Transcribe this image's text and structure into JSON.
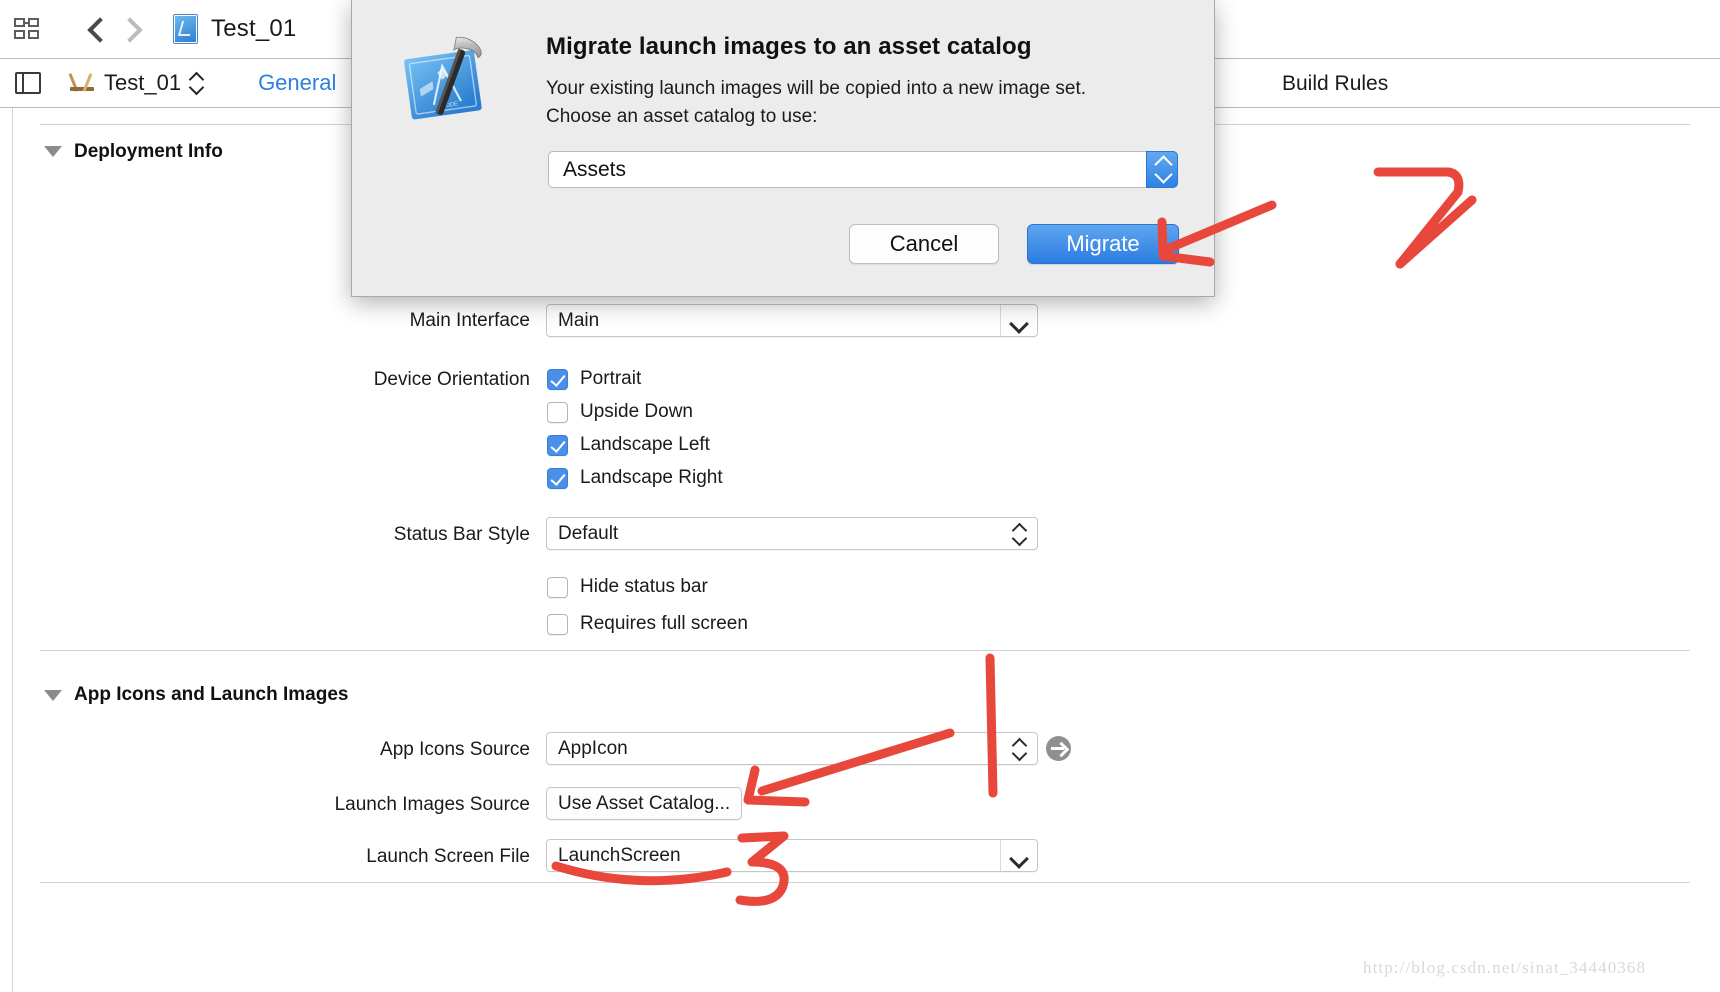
{
  "toolbar": {
    "grid_icon": "grid-icon",
    "back_icon": "chevron-left-icon",
    "forward_icon": "chevron-right-icon",
    "file_icon": "xcode-project-file-icon",
    "title": "Test_01"
  },
  "tabbar": {
    "panel_icon": "left-panel-toggle-icon",
    "target_icon": "target-ruler-icon",
    "scheme_name": "Test_01",
    "stepper_icon": "up-down-stepper-icon",
    "tabs": [
      {
        "label": "General",
        "active": true
      },
      {
        "label": "Build Rules",
        "active": false
      }
    ]
  },
  "sections": {
    "deployment_info": {
      "title": "Deployment Info",
      "disclosure_icon": "triangle-down-icon",
      "rows": {
        "main_interface": {
          "label": "Main Interface",
          "value": "Main",
          "control": "combo-box",
          "icon": "chevron-down-icon"
        },
        "device_orientation": {
          "label": "Device Orientation",
          "options": [
            {
              "label": "Portrait",
              "checked": true
            },
            {
              "label": "Upside Down",
              "checked": false
            },
            {
              "label": "Landscape Left",
              "checked": true
            },
            {
              "label": "Landscape Right",
              "checked": true
            }
          ]
        },
        "status_bar_style": {
          "label": "Status Bar Style",
          "value": "Default",
          "control": "popup-button",
          "icon": "up-down-stepper-icon"
        },
        "extra_checks": [
          {
            "label": "Hide status bar",
            "checked": false
          },
          {
            "label": "Requires full screen",
            "checked": false
          }
        ]
      }
    },
    "app_icons_and_launch_images": {
      "title": "App Icons and Launch Images",
      "disclosure_icon": "triangle-down-icon",
      "rows": {
        "app_icons_source": {
          "label": "App Icons Source",
          "value": "AppIcon",
          "icon": "up-down-stepper-icon",
          "goto_icon": "arrow-right-circle-icon"
        },
        "launch_images_source": {
          "label": "Launch Images Source",
          "value": "Use Asset Catalog..."
        },
        "launch_screen_file": {
          "label": "Launch Screen File",
          "value": "LaunchScreen",
          "icon": "chevron-down-icon"
        }
      }
    }
  },
  "dialog": {
    "icon": "xcode-hammer-blueprint-icon",
    "title": "Migrate launch images to an asset catalog",
    "body_line1": "Your existing launch images will be copied into a new image set.",
    "body_line2": "Choose an asset catalog to use:",
    "catalog_field": {
      "value": "Assets",
      "stepper_icon": "blue-up-down-stepper-icon"
    },
    "cancel_label": "Cancel",
    "migrate_label": "Migrate"
  },
  "annotations": {
    "color": "#e8473c",
    "marks": [
      {
        "name": "handwritten-2",
        "text": "2"
      },
      {
        "name": "handwritten-3",
        "text": "3"
      },
      {
        "name": "arrow-to-migrate-button"
      },
      {
        "name": "arrow-to-launch-images-source"
      },
      {
        "name": "underline-launch-screen-file"
      },
      {
        "name": "vertical-line-divider"
      }
    ]
  },
  "watermark": {
    "text": "http://blog.csdn.net/sinat_34440368"
  }
}
